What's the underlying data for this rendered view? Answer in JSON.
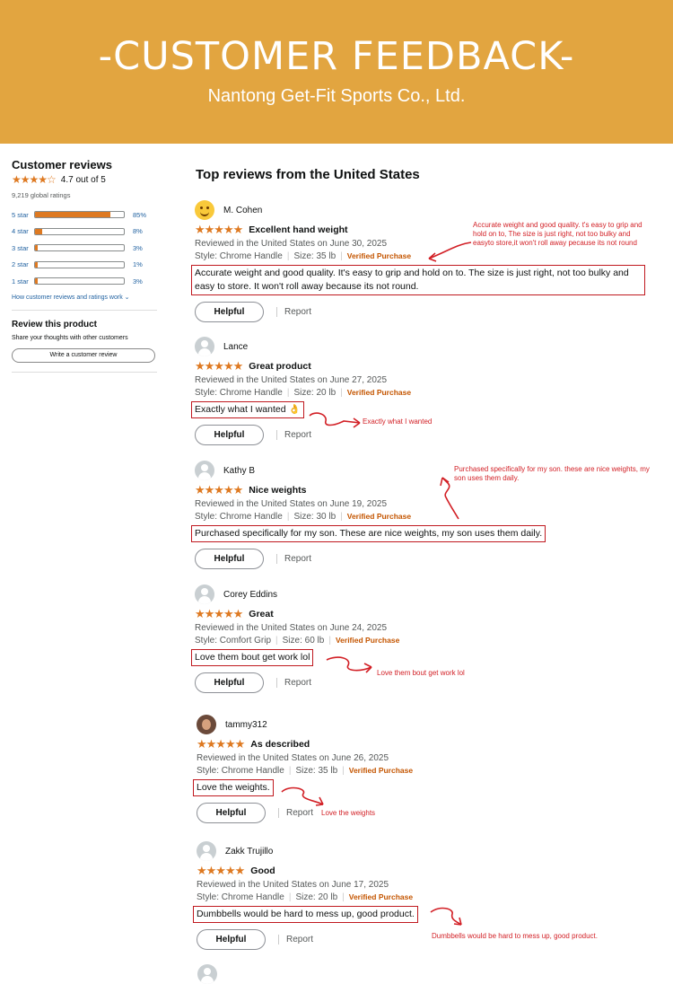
{
  "banner": {
    "title": "-CUSTOMER FEEDBACK-",
    "subtitle": "Nantong Get-Fit Sports Co., Ltd."
  },
  "summary": {
    "title": "Customer reviews",
    "stars": "★★★★☆",
    "rating_text": "4.7 out of 5",
    "global_ratings": "9,219 global ratings",
    "histogram": [
      {
        "label": "5 star",
        "pct": "85%",
        "value": 85
      },
      {
        "label": "4 star",
        "pct": "8%",
        "value": 8
      },
      {
        "label": "3 star",
        "pct": "3%",
        "value": 3
      },
      {
        "label": "2 star",
        "pct": "1%",
        "value": 1
      },
      {
        "label": "1 star",
        "pct": "3%",
        "value": 3
      }
    ],
    "how_link": "How customer reviews and ratings work",
    "review_product_title": "Review this product",
    "review_product_sub": "Share your thoughts with other customers",
    "write_button": "Write a customer review"
  },
  "reviews_title": "Top reviews from the United States",
  "reviews": [
    {
      "user": "M. Cohen",
      "stars": "★★★★★",
      "title": "Excellent hand weight",
      "meta": "Reviewed in the United States on June 30, 2025",
      "style": "Style: Chrome Handle",
      "size": "Size: 35 lb",
      "verified": "Verified Purchase",
      "text": "Accurate weight and good quality. It's easy to grip and hold on to. The size is just right, not too bulky and easy to store. It won't roll away because its not round.",
      "helpful": "Helpful",
      "report": "Report",
      "note": "Accurate weight and good quality. t's easy to grip and hold on to, The size is just right, not too bulky and easyto store,it won't roll away pecause its not round"
    },
    {
      "user": "Lance",
      "stars": "★★★★★",
      "title": "Great product",
      "meta": "Reviewed in the United States on June 27, 2025",
      "style": "Style: Chrome Handle",
      "size": "Size: 20 lb",
      "verified": "Verified Purchase",
      "text": "Exactly what I wanted 👌",
      "helpful": "Helpful",
      "report": "Report",
      "note": "Exactly what I wanted"
    },
    {
      "user": "Kathy B",
      "stars": "★★★★★",
      "title": "Nice weights",
      "meta": "Reviewed in the United States on June 19, 2025",
      "style": "Style: Chrome Handle",
      "size": "Size: 30 lb",
      "verified": "Verified Purchase",
      "text": "Purchased specifically for my son. These are nice weights, my son uses them daily.",
      "helpful": "Helpful",
      "report": "Report",
      "note": "Purchased specifically for my son. these are nice weights, my son uses them daily."
    },
    {
      "user": "Corey Eddins",
      "stars": "★★★★★",
      "title": "Great",
      "meta": "Reviewed in the United States on June 24, 2025",
      "style": "Style: Comfort Grip",
      "size": "Size: 60 lb",
      "verified": "Verified Purchase",
      "text": "Love them bout get work lol",
      "helpful": "Helpful",
      "report": "Report",
      "note": "Love them bout get work lol"
    },
    {
      "user": "tammy312",
      "stars": "★★★★★",
      "title": "As described",
      "meta": "Reviewed in the United States on June 26, 2025",
      "style": "Style: Chrome Handle",
      "size": "Size: 35 lb",
      "verified": "Verified Purchase",
      "text": "Love the weights.",
      "helpful": "Helpful",
      "report": "Report",
      "note": "Love the weights"
    },
    {
      "user": "Zakk Trujillo",
      "stars": "★★★★★",
      "title": "Good",
      "meta": "Reviewed in the United States on June 17, 2025",
      "style": "Style: Chrome Handle",
      "size": "Size: 20 lb",
      "verified": "Verified Purchase",
      "text": "Dumbbells would be hard to mess up, good product.",
      "helpful": "Helpful",
      "report": "Report",
      "note": "Dumbbells would be hard to mess up, good product."
    }
  ]
}
